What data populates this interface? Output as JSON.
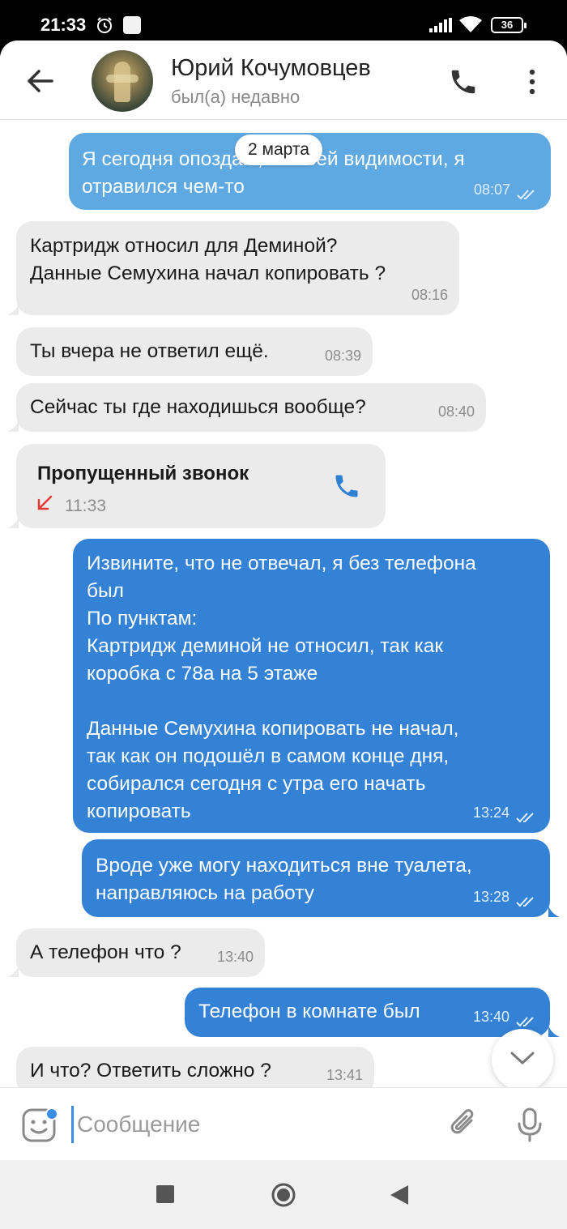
{
  "status_bar": {
    "time": "21:33",
    "battery": "36",
    "icons": [
      "alarm-icon",
      "app-notification-icon",
      "signal-icon",
      "wifi-icon",
      "battery-icon"
    ]
  },
  "header": {
    "contact_name": "Юрий Кочумовцев",
    "contact_status": "был(а) недавно",
    "icons": [
      "back-arrow-icon",
      "phone-icon",
      "more-vertical-icon"
    ]
  },
  "chat": {
    "date_chip": "2 марта",
    "messages": [
      {
        "direction": "out",
        "text": "Я сегодня опоздаю, по всей видимости, я\nотравился чем-то",
        "time": "08:07",
        "read": true
      },
      {
        "direction": "in",
        "text": "Картридж относил для Деминой?\nДанные Семухина начал копировать ?",
        "time": "08:16"
      },
      {
        "direction": "in",
        "text": "Ты вчера не ответил ещё.",
        "time": "08:39"
      },
      {
        "direction": "in",
        "text": "Сейчас ты где находишься вообще?",
        "time": "08:40"
      },
      {
        "direction": "in",
        "type": "missed_call",
        "text": "Пропущенный звонок",
        "time": "11:33"
      },
      {
        "direction": "out",
        "text": "Извините, что не отвечал, я без телефона\nбыл\nПо пунктам:\nКартридж деминой не относил, так как\nкоробка с 78а на 5 этаже\n\nДанные Семухина копировать не начал,\nтак как он подошёл в самом конце дня,\nсобирался сегодня с утра его начать\nкопировать",
        "time": "13:24",
        "read": true
      },
      {
        "direction": "out",
        "text": "Вроде уже могу находиться вне туалета,\nнаправляюсь на работу",
        "time": "13:28",
        "read": true
      },
      {
        "direction": "in",
        "text": "А телефон что ?",
        "time": "13:40"
      },
      {
        "direction": "out",
        "text": "Телефон в комнате был",
        "time": "13:40",
        "read": true
      },
      {
        "direction": "in",
        "text": "И что? Ответить сложно ?",
        "time": "13:41"
      }
    ]
  },
  "composer": {
    "placeholder": "Сообщение",
    "value": "",
    "icons": [
      "sticker-icon",
      "attach-icon",
      "microphone-icon"
    ]
  },
  "colors": {
    "incoming_bubble": "#ebebeb",
    "outgoing_bubble": "#3482d6",
    "outgoing_bubble_light": "#5ea9e2",
    "accent": "#3a8ee6",
    "missed_call_arrow": "#e53935"
  }
}
